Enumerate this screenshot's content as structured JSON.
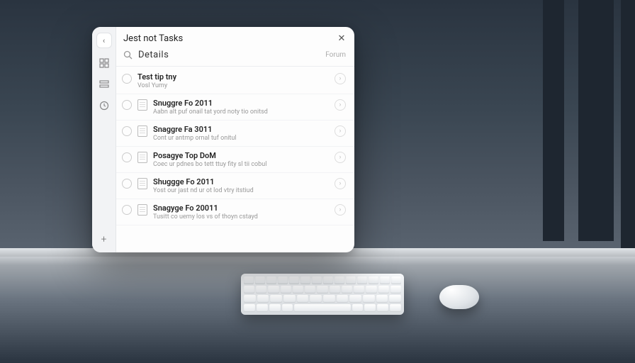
{
  "window": {
    "title": "Jest not Tasks",
    "close_glyph": "✕"
  },
  "search": {
    "icon_glyph": "⌕",
    "text": "Details",
    "filter_label": "Forum"
  },
  "sidebar": {
    "top_glyph": "‹",
    "add_glyph": "+"
  },
  "tasks": [
    {
      "title": "Test tip tny",
      "subtitle": "Vosl Yumy"
    },
    {
      "title": "Snuggre Fo 2011",
      "subtitle": "Aabn alt puf onail tat yord noty tio onitsd"
    },
    {
      "title": "Snaggre Fa 3011",
      "subtitle": "Cont ur antmp ornal tuf onitul"
    },
    {
      "title": "Posagye Top DoM",
      "subtitle": "Coec ur pdnes bo tett ttuy fity sl tii cobul"
    },
    {
      "title": "Shuggge Fo 2011",
      "subtitle": "Yost our jast nd ur ot lod vtry itstiud"
    },
    {
      "title": "Snagyge Fo 20011",
      "subtitle": "Tusitt co uemy los vs of thoyn cstayd"
    }
  ],
  "row_icons": {
    "status_glyph": "",
    "action_glyph": "›"
  }
}
